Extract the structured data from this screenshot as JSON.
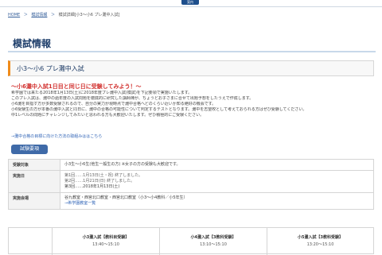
{
  "header": {
    "tab_label": "案内"
  },
  "breadcrumb": {
    "items": [
      "HOME",
      "＞",
      "模試情報",
      "＞",
      "模試詳細[小3〜小6 プレ灘中入試]"
    ]
  },
  "page_title": "模試情報",
  "section_title": "小3〜小6 プレ灘中入試",
  "headline": "〜小6灘中入試1日目と同じ日に受験してみよう！〜",
  "body_lines": [
    "希学園では来たる2018年1月13日(土)に2018年度プレ灘中入試(模試)を下記要領で実施いたします。",
    "このプレ入試は、灘中の過年度の入試問題を徹底的に研究した講師陣が、ちょうどお子さまに合せて出題予想をしたうえで作成します。",
    "小6灘を目指す方が多数受験されるので、自分の実力が現時点で灘中合格へどのくらい近いか知る絶好の機会です。",
    "小6受験生の方が本番の灘中入試と同日に、灘中の合格の可能性について判定するテストとなります。灘中を志望校として考えておられる方はぜひ受験してください。",
    "中1レベルの問題にチャレンジしてみたいと思われる方も大歓迎いたします。ぜひ積極的にご受験ください。"
  ],
  "link_text": "→灘中合格の目標に向けた方法の取組みははこちら",
  "pill_label": "試験要項",
  "info_table": [
    {
      "label": "受験対象",
      "lines": [
        "小3生〜小6生(他生一般生の方)  ※女子の方の受験も大歓迎です。"
      ]
    },
    {
      "label": "実施日",
      "lines": [
        "第1回……1月13日(土・祝)  終了しました。",
        "第2回……1月21日(日)  終了しました。",
        "第3回……2018年1月13日(土)"
      ]
    },
    {
      "label": "実施会場",
      "lines": [
        "谷九教室・西宮北口教室・西宮北口教室（小3〜小4教科／小5年生）",
        "→希学園教室一覧"
      ]
    }
  ],
  "schedule_cols": [
    {
      "title": "小3灘入試【教科目受験】",
      "time": "13:40〜15:10"
    },
    {
      "title": "小4灘入試【3教科受験】",
      "time": "13:10〜15:10"
    },
    {
      "title": "小5灘入試【3教科受験】",
      "time": "13:20〜15:10"
    }
  ]
}
